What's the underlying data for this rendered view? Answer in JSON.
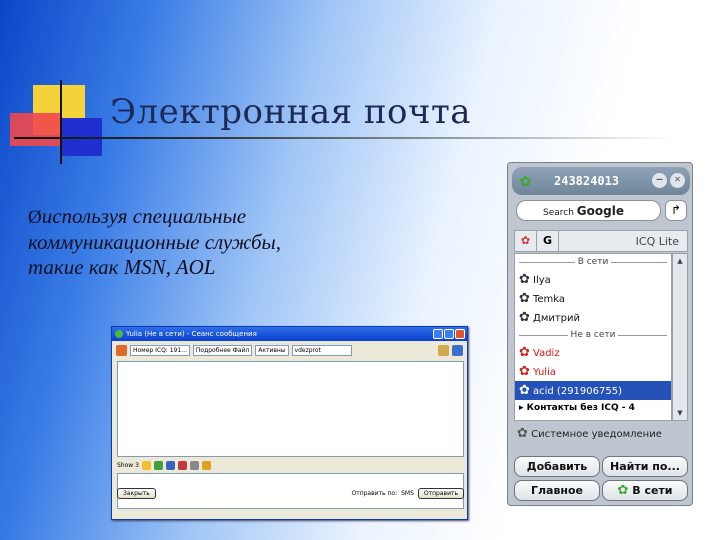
{
  "slide": {
    "title": "Электронная почта",
    "bullet_marker": "Ø",
    "bullet_text": "используя специальные коммуникационные службы, такие как MSN, AOL"
  },
  "message_window": {
    "title": "Yulia (Не в сети) - Сеанс сообщения",
    "icq_number_label": "Номер ICQ: 191...",
    "history_label": "Подробнее Файл",
    "to_label": "Активны",
    "status_field": "vdezprot",
    "mid_label": "Show 3",
    "send_via_label": "Отправить по:",
    "sms_label": "SMS",
    "close_button": "Закрыть",
    "send_button": "Отправить"
  },
  "icq": {
    "uin": "243824013",
    "search_prefix": "Search",
    "search_brand": "Google",
    "tab_name": "ICQ Lite",
    "online_header": "В сети",
    "offline_header": "Не в сети",
    "online_contacts": [
      "Ilya",
      "Temka",
      "Дмитрий"
    ],
    "offline_contacts": [
      "Vadiz",
      "Yulia",
      "acid (291906755)"
    ],
    "selected_contact": "acid (291906755)",
    "group_label": "Контакты без ICQ - 4",
    "system_note": "Системное уведомление",
    "add_button": "Добавить",
    "find_button": "Найти по...",
    "main_button": "Главное",
    "status_button": "В сети"
  },
  "colors": {
    "accent": "#0b46c8",
    "icq_green": "#3aa82a",
    "offline_red": "#d11111",
    "selection": "#2452b8"
  }
}
